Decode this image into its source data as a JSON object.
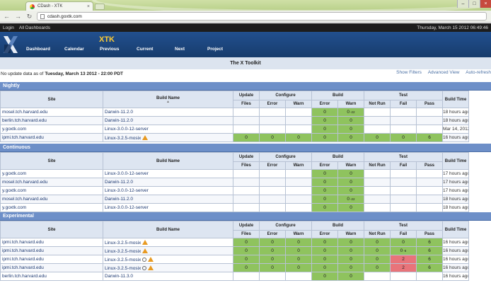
{
  "browser": {
    "tab_title": "CDash - XTK",
    "tab_close": "×",
    "url": "cdash.goxtk.com",
    "win_buttons": [
      "–",
      "□",
      "×"
    ],
    "nav": [
      "←",
      "→",
      "↻"
    ]
  },
  "topbar": {
    "links": [
      "Login",
      "All Dashboards"
    ],
    "date": "Thursday, March 15 2012 06:49:46"
  },
  "header": {
    "project": "XTK",
    "menu": [
      "Dashboard",
      "Calendar",
      "Previous",
      "Current",
      "Next",
      "Project"
    ],
    "title": "The X Toolkit"
  },
  "info": {
    "prefix": "No update data as of",
    "date": "Tuesday, March 13 2012 - 22:00 PDT",
    "links": [
      "Show Filters",
      "Advanced View",
      "Auto-refresh"
    ]
  },
  "columns": {
    "site": "Site",
    "build_name": "Build Name",
    "update": "Update",
    "configure": "Configure",
    "build": "Build",
    "test": "Test",
    "build_time": "Build Time",
    "files": "Files",
    "error": "Error",
    "warn": "Warn",
    "not_run": "Not Run",
    "fail": "Fail",
    "pass": "Pass"
  },
  "colors": {
    "green": "#8fc35e",
    "red": "#e8747a",
    "section": "#6d8fc8"
  },
  "sections": [
    {
      "name": "Nightly",
      "rows": [
        {
          "site": "mosel.tch.harvard.edu",
          "build": "Darwin-11.2.0",
          "icons": [],
          "files": "",
          "cerr": "",
          "cwarn": "",
          "berr": "0",
          "bwarn": "0",
          "bwarn_sub": "-22",
          "nrun": "",
          "fail": "",
          "pass": "",
          "time": "18 hours ago",
          "green": [
            "berr",
            "bwarn"
          ]
        },
        {
          "site": "berlin.tch.harvard.edu",
          "build": "Darwin-11.2.0",
          "icons": [],
          "files": "",
          "cerr": "",
          "cwarn": "",
          "berr": "0",
          "bwarn": "0",
          "bwarn_sub": "",
          "nrun": "",
          "fail": "",
          "pass": "",
          "time": "18 hours ago",
          "green": [
            "berr",
            "bwarn"
          ]
        },
        {
          "site": "y.goxtk.com",
          "build": "Linux-3.0.0-12-server",
          "icons": [],
          "files": "",
          "cerr": "",
          "cwarn": "",
          "berr": "0",
          "bwarn": "0",
          "bwarn_sub": "",
          "nrun": "",
          "fail": "",
          "pass": "",
          "time": "Mar 14, 2012 - 03:",
          "green": [
            "berr",
            "bwarn"
          ]
        },
        {
          "site": "ipmi.tch.harvard.edu",
          "build": "Linux-3.2.5-mosix",
          "icons": [
            "warning-icon"
          ],
          "files": "0",
          "cerr": "0",
          "cwarn": "0",
          "berr": "0",
          "bwarn": "0",
          "bwarn_sub": "",
          "nrun": "0",
          "fail": "0",
          "pass": "6",
          "time": "16 hours ago",
          "green": [
            "files",
            "cerr",
            "cwarn",
            "berr",
            "bwarn",
            "nrun",
            "fail",
            "pass"
          ]
        }
      ]
    },
    {
      "name": "Continuous",
      "rows": [
        {
          "site": "y.goxtk.com",
          "build": "Linux-3.0.0-12-server",
          "icons": [],
          "files": "",
          "cerr": "",
          "cwarn": "",
          "berr": "0",
          "bwarn": "0",
          "bwarn_sub": "",
          "nrun": "",
          "fail": "",
          "pass": "",
          "time": "17 hours ago",
          "green": [
            "berr",
            "bwarn"
          ]
        },
        {
          "site": "mosel.tch.harvard.edu",
          "build": "Darwin-11.2.0",
          "icons": [],
          "files": "",
          "cerr": "",
          "cwarn": "",
          "berr": "0",
          "bwarn": "0",
          "bwarn_sub": "",
          "nrun": "",
          "fail": "",
          "pass": "",
          "time": "17 hours ago",
          "green": [
            "berr",
            "bwarn"
          ]
        },
        {
          "site": "y.goxtk.com",
          "build": "Linux-3.0.0-12-server",
          "icons": [],
          "files": "",
          "cerr": "",
          "cwarn": "",
          "berr": "0",
          "bwarn": "0",
          "bwarn_sub": "",
          "nrun": "",
          "fail": "",
          "pass": "",
          "time": "17 hours ago",
          "green": [
            "berr",
            "bwarn"
          ]
        },
        {
          "site": "mosel.tch.harvard.edu",
          "build": "Darwin-11.2.0",
          "icons": [],
          "files": "",
          "cerr": "",
          "cwarn": "",
          "berr": "0",
          "bwarn": "0",
          "bwarn_sub": "-22",
          "nrun": "",
          "fail": "",
          "pass": "",
          "time": "18 hours ago",
          "green": [
            "berr",
            "bwarn"
          ]
        },
        {
          "site": "y.goxtk.com",
          "build": "Linux-3.0.0-12-server",
          "icons": [],
          "files": "",
          "cerr": "",
          "cwarn": "",
          "berr": "0",
          "bwarn": "0",
          "bwarn_sub": "",
          "nrun": "",
          "fail": "",
          "pass": "",
          "time": "18 hours ago",
          "green": [
            "berr",
            "bwarn"
          ]
        }
      ]
    },
    {
      "name": "Experimental",
      "rows": [
        {
          "site": "ipmi.tch.harvard.edu",
          "build": "Linux-3.2.5-mosix",
          "icons": [
            "warning-icon"
          ],
          "files": "0",
          "cerr": "0",
          "cwarn": "0",
          "berr": "0",
          "bwarn": "0",
          "bwarn_sub": "",
          "nrun": "0",
          "fail": "0",
          "fail_sub": "",
          "pass": "6",
          "time": "16 hours ago",
          "green": [
            "files",
            "cerr",
            "cwarn",
            "berr",
            "bwarn",
            "nrun",
            "fail",
            "pass"
          ]
        },
        {
          "site": "ipmi.tch.harvard.edu",
          "build": "Linux-3.2.5-mosix",
          "icons": [
            "warning-icon"
          ],
          "files": "0",
          "cerr": "0",
          "cwarn": "0",
          "berr": "0",
          "bwarn": "0",
          "bwarn_sub": "",
          "nrun": "0",
          "fail": "0",
          "fail_sub": "-6",
          "pass": "6",
          "time": "16 hours ago",
          "green": [
            "files",
            "cerr",
            "cwarn",
            "berr",
            "bwarn",
            "nrun",
            "fail",
            "pass"
          ]
        },
        {
          "site": "ipmi.tch.harvard.edu",
          "build": "Linux-3.2.5-mosix",
          "icons": [
            "note-icon",
            "warning-icon"
          ],
          "files": "0",
          "cerr": "0",
          "cwarn": "0",
          "berr": "0",
          "bwarn": "0",
          "bwarn_sub": "",
          "nrun": "0",
          "fail": "2",
          "fail_sub": "",
          "pass": "6",
          "time": "16 hours ago",
          "green": [
            "files",
            "cerr",
            "cwarn",
            "berr",
            "bwarn",
            "nrun",
            "pass"
          ],
          "red": [
            "fail"
          ]
        },
        {
          "site": "ipmi.tch.harvard.edu",
          "build": "Linux-3.2.5-mosix",
          "icons": [
            "note-icon",
            "warning-icon"
          ],
          "files": "0",
          "cerr": "0",
          "cwarn": "0",
          "berr": "0",
          "bwarn": "0",
          "bwarn_sub": "",
          "nrun": "0",
          "fail": "2",
          "fail_sub": "",
          "pass": "6",
          "time": "16 hours ago",
          "green": [
            "files",
            "cerr",
            "cwarn",
            "berr",
            "bwarn",
            "nrun",
            "pass"
          ],
          "red": [
            "fail"
          ]
        },
        {
          "site": "berlin.tch.harvard.edu",
          "build": "Darwin-11.3.0",
          "icons": [],
          "files": "",
          "cerr": "",
          "cwarn": "",
          "berr": "0",
          "bwarn": "0",
          "bwarn_sub": "",
          "nrun": "",
          "fail": "",
          "fail_sub": "",
          "pass": "",
          "time": "16 hours ago",
          "green": [
            "berr",
            "bwarn"
          ]
        }
      ]
    }
  ]
}
